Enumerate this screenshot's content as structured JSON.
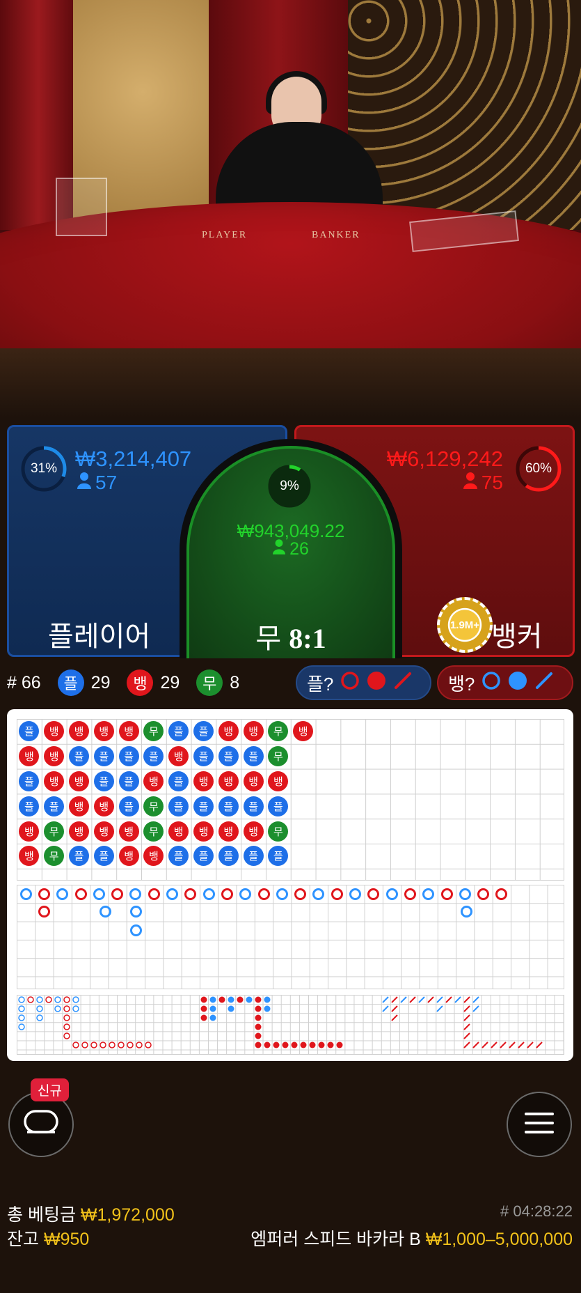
{
  "video": {
    "felt_player": "PLAYER",
    "felt_banker": "BANKER"
  },
  "player": {
    "percent": "31%",
    "percent_value": 0.31,
    "amount": "₩3,214,407",
    "players": "57",
    "label": "플레이어",
    "color": "#1e8be8"
  },
  "tie": {
    "percent": "9%",
    "percent_value": 0.09,
    "amount": "₩943,049.22",
    "players": "26",
    "label": "무",
    "payout": "8:1",
    "color": "#22d32b"
  },
  "banker": {
    "percent": "60%",
    "percent_value": 0.6,
    "amount": "₩6,129,242",
    "players": "75",
    "label": "뱅커",
    "color": "#ff1a1a",
    "chip": "1.9M+"
  },
  "stats": {
    "round": "# 66",
    "player_badge": "플",
    "player_count": "29",
    "banker_badge": "뱅",
    "banker_count": "29",
    "tie_badge": "무",
    "tie_count": "8"
  },
  "predict": {
    "player_label": "플?",
    "banker_label": "뱅?"
  },
  "bead_road": [
    [
      "플",
      "뱅",
      "뱅",
      "뱅",
      "뱅",
      "무",
      "플",
      "플",
      "뱅",
      "뱅",
      "무",
      "뱅"
    ],
    [
      "뱅",
      "뱅",
      "플",
      "플",
      "플",
      "플",
      "뱅",
      "플",
      "플",
      "플",
      "무"
    ],
    [
      "플",
      "뱅",
      "뱅",
      "플",
      "플",
      "뱅",
      "플",
      "뱅",
      "뱅",
      "뱅",
      "뱅"
    ],
    [
      "플",
      "플",
      "뱅",
      "뱅",
      "플",
      "무",
      "플",
      "플",
      "플",
      "플",
      "플"
    ],
    [
      "뱅",
      "무",
      "뱅",
      "뱅",
      "뱅",
      "무",
      "뱅",
      "뱅",
      "뱅",
      "뱅",
      "무"
    ],
    [
      "뱅",
      "무",
      "플",
      "플",
      "뱅",
      "뱅",
      "플",
      "플",
      "플",
      "플",
      "플"
    ]
  ],
  "big_road_top": [
    "b",
    "r",
    "b",
    "r",
    "b",
    "r",
    "b",
    "r",
    "b",
    "r",
    "b",
    "r",
    "b",
    "r",
    "b",
    "r",
    "b",
    "r",
    "b",
    "r",
    "b",
    "r",
    "b",
    "r",
    "b",
    "r",
    "r"
  ],
  "footer": {
    "total_bet_label": "총 베팅금",
    "total_bet": "₩1,972,000",
    "balance_label": "잔고",
    "balance": "₩950",
    "game_id": "# 04:28:22",
    "table_name": "엠퍼러 스피드 바카라 B",
    "limits": "₩1,000–5,000,000",
    "new_badge": "신규"
  },
  "icons": {
    "chat": "chat-icon",
    "menu": "menu-icon"
  }
}
